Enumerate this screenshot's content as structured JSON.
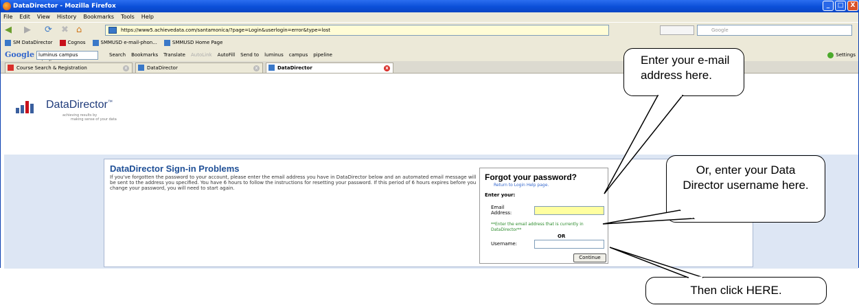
{
  "window": {
    "title": "DataDirector - Mozilla Firefox",
    "controls": [
      "_",
      "□",
      "X"
    ]
  },
  "menu": [
    "File",
    "Edit",
    "View",
    "History",
    "Bookmarks",
    "Tools",
    "Help"
  ],
  "nav": {
    "url": "https://www5.achievedata.com/santamonica/?page=Login&userlogin=error&type=lost",
    "search_placeholder": "Google"
  },
  "bookmarks": [
    "SM DataDirector",
    "Cognos",
    "SMMUSD e-mail-phon...",
    "SMMUSD Home Page"
  ],
  "google_toolbar": {
    "logo": "Google",
    "query": "luminus campus pipeline",
    "items": [
      "Search",
      "Bookmarks",
      "Translate",
      "AutoLink",
      "AutoFill",
      "Send to",
      "luminus",
      "campus",
      "pipeline"
    ],
    "settings": "Settings"
  },
  "tabs": [
    {
      "label": "Course Search & Registration"
    },
    {
      "label": "DataDirector"
    },
    {
      "label": "DataDirector"
    }
  ],
  "logo": {
    "name": "DataDirector",
    "tm": "™",
    "tagline_1": "achieving results by",
    "tagline_2": "making sense of your data"
  },
  "main": {
    "title": "DataDirector Sign-in Problems",
    "body": "If you've forgotten the password to your account, please enter the email address you have in DataDirector below and an automated email message will be sent to the address you specified. You have 6 hours to follow the instructions for resetting your password. If this period of 6 hours expires before you change your password, you will need to start again."
  },
  "form": {
    "heading": "Forgot your password?",
    "return_link": "Return to Login Help page.",
    "enter_label": "Enter your:",
    "email_label": "Email Address:",
    "email_note": "**Enter the email address that is currently in DataDirector**",
    "or": "OR",
    "username_label": "Username:",
    "continue": "Continue"
  },
  "callouts": {
    "email": "Enter your e-mail address here.",
    "username": "Or, enter your Data Director username here.",
    "continue": "Then click HERE."
  }
}
